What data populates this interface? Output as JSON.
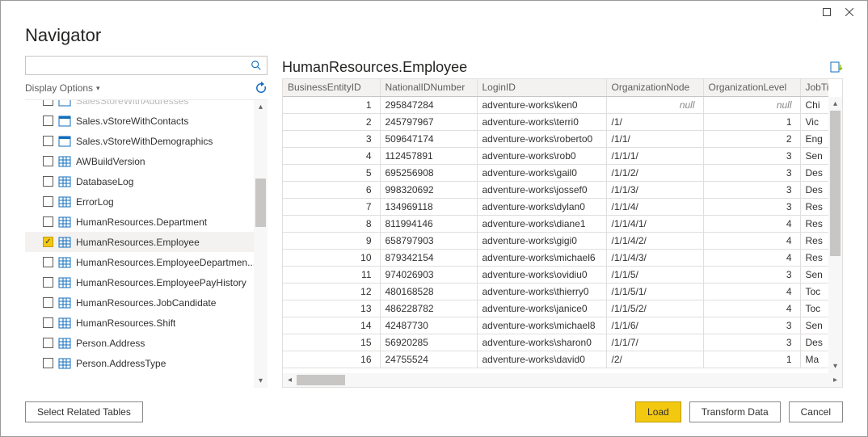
{
  "window": {
    "title": "Navigator"
  },
  "left": {
    "displayOptionsLabel": "Display Options",
    "searchPlaceholder": "",
    "tree": [
      {
        "label": "SalesStoreWithAddresses",
        "icon": "view",
        "checked": false,
        "cut": true
      },
      {
        "label": "Sales.vStoreWithContacts",
        "icon": "view",
        "checked": false
      },
      {
        "label": "Sales.vStoreWithDemographics",
        "icon": "view",
        "checked": false
      },
      {
        "label": "AWBuildVersion",
        "icon": "table",
        "checked": false
      },
      {
        "label": "DatabaseLog",
        "icon": "table",
        "checked": false
      },
      {
        "label": "ErrorLog",
        "icon": "table",
        "checked": false
      },
      {
        "label": "HumanResources.Department",
        "icon": "table",
        "checked": false
      },
      {
        "label": "HumanResources.Employee",
        "icon": "table",
        "checked": true,
        "selected": true
      },
      {
        "label": "HumanResources.EmployeeDepartmen...",
        "icon": "table",
        "checked": false
      },
      {
        "label": "HumanResources.EmployeePayHistory",
        "icon": "table",
        "checked": false
      },
      {
        "label": "HumanResources.JobCandidate",
        "icon": "table",
        "checked": false
      },
      {
        "label": "HumanResources.Shift",
        "icon": "table",
        "checked": false
      },
      {
        "label": "Person.Address",
        "icon": "table",
        "checked": false
      },
      {
        "label": "Person.AddressType",
        "icon": "table",
        "checked": false
      }
    ]
  },
  "preview": {
    "title": "HumanResources.Employee",
    "columns": [
      "BusinessEntityID",
      "NationalIDNumber",
      "LoginID",
      "OrganizationNode",
      "OrganizationLevel",
      "JobTitle"
    ],
    "rows": [
      {
        "BusinessEntityID": 1,
        "NationalIDNumber": "295847284",
        "LoginID": "adventure-works\\ken0",
        "OrganizationNode": null,
        "OrganizationLevel": null,
        "JobTitle": "Chi"
      },
      {
        "BusinessEntityID": 2,
        "NationalIDNumber": "245797967",
        "LoginID": "adventure-works\\terri0",
        "OrganizationNode": "/1/",
        "OrganizationLevel": 1,
        "JobTitle": "Vic"
      },
      {
        "BusinessEntityID": 3,
        "NationalIDNumber": "509647174",
        "LoginID": "adventure-works\\roberto0",
        "OrganizationNode": "/1/1/",
        "OrganizationLevel": 2,
        "JobTitle": "Eng"
      },
      {
        "BusinessEntityID": 4,
        "NationalIDNumber": "112457891",
        "LoginID": "adventure-works\\rob0",
        "OrganizationNode": "/1/1/1/",
        "OrganizationLevel": 3,
        "JobTitle": "Sen"
      },
      {
        "BusinessEntityID": 5,
        "NationalIDNumber": "695256908",
        "LoginID": "adventure-works\\gail0",
        "OrganizationNode": "/1/1/2/",
        "OrganizationLevel": 3,
        "JobTitle": "Des"
      },
      {
        "BusinessEntityID": 6,
        "NationalIDNumber": "998320692",
        "LoginID": "adventure-works\\jossef0",
        "OrganizationNode": "/1/1/3/",
        "OrganizationLevel": 3,
        "JobTitle": "Des"
      },
      {
        "BusinessEntityID": 7,
        "NationalIDNumber": "134969118",
        "LoginID": "adventure-works\\dylan0",
        "OrganizationNode": "/1/1/4/",
        "OrganizationLevel": 3,
        "JobTitle": "Res"
      },
      {
        "BusinessEntityID": 8,
        "NationalIDNumber": "811994146",
        "LoginID": "adventure-works\\diane1",
        "OrganizationNode": "/1/1/4/1/",
        "OrganizationLevel": 4,
        "JobTitle": "Res"
      },
      {
        "BusinessEntityID": 9,
        "NationalIDNumber": "658797903",
        "LoginID": "adventure-works\\gigi0",
        "OrganizationNode": "/1/1/4/2/",
        "OrganizationLevel": 4,
        "JobTitle": "Res"
      },
      {
        "BusinessEntityID": 10,
        "NationalIDNumber": "879342154",
        "LoginID": "adventure-works\\michael6",
        "OrganizationNode": "/1/1/4/3/",
        "OrganizationLevel": 4,
        "JobTitle": "Res"
      },
      {
        "BusinessEntityID": 11,
        "NationalIDNumber": "974026903",
        "LoginID": "adventure-works\\ovidiu0",
        "OrganizationNode": "/1/1/5/",
        "OrganizationLevel": 3,
        "JobTitle": "Sen"
      },
      {
        "BusinessEntityID": 12,
        "NationalIDNumber": "480168528",
        "LoginID": "adventure-works\\thierry0",
        "OrganizationNode": "/1/1/5/1/",
        "OrganizationLevel": 4,
        "JobTitle": "Toc"
      },
      {
        "BusinessEntityID": 13,
        "NationalIDNumber": "486228782",
        "LoginID": "adventure-works\\janice0",
        "OrganizationNode": "/1/1/5/2/",
        "OrganizationLevel": 4,
        "JobTitle": "Toc"
      },
      {
        "BusinessEntityID": 14,
        "NationalIDNumber": "42487730",
        "LoginID": "adventure-works\\michael8",
        "OrganizationNode": "/1/1/6/",
        "OrganizationLevel": 3,
        "JobTitle": "Sen"
      },
      {
        "BusinessEntityID": 15,
        "NationalIDNumber": "56920285",
        "LoginID": "adventure-works\\sharon0",
        "OrganizationNode": "/1/1/7/",
        "OrganizationLevel": 3,
        "JobTitle": "Des"
      },
      {
        "BusinessEntityID": 16,
        "NationalIDNumber": "24755524",
        "LoginID": "adventure-works\\david0",
        "OrganizationNode": "/2/",
        "OrganizationLevel": 1,
        "JobTitle": "Ma"
      }
    ]
  },
  "footer": {
    "selectRelated": "Select Related Tables",
    "load": "Load",
    "transform": "Transform Data",
    "cancel": "Cancel"
  }
}
